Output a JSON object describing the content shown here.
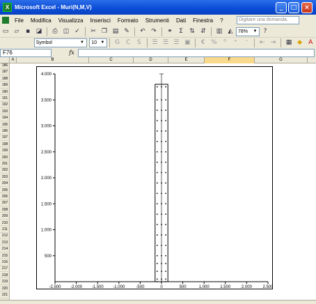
{
  "window": {
    "title": "Microsoft Excel - Muri(N,M,V)",
    "minimize": "_",
    "maximize": "□",
    "close": "×"
  },
  "menu": {
    "items": [
      "File",
      "Modifica",
      "Visualizza",
      "Inserisci",
      "Formato",
      "Strumenti",
      "Dati",
      "Finestra",
      "?"
    ],
    "help_placeholder": "Digitare una domanda."
  },
  "toolbar": {
    "zoom": "78%",
    "font": "Symbol",
    "size": "10"
  },
  "formula_bar": {
    "name_box": "F76",
    "fx": "fx",
    "content": ""
  },
  "sheet": {
    "columns": [
      "A",
      "B",
      "C",
      "D",
      "E",
      "F",
      "G"
    ],
    "selected_column": "F",
    "rows": [
      "186",
      "187",
      "188",
      "189",
      "190",
      "191",
      "192",
      "193",
      "194",
      "195",
      "196",
      "197",
      "198",
      "199",
      "200",
      "201",
      "202",
      "203",
      "204",
      "205",
      "206",
      "207",
      "208",
      "209",
      "210",
      "211",
      "212",
      "213",
      "214",
      "215",
      "216",
      "217",
      "218",
      "219",
      "220",
      "221"
    ]
  },
  "chart_data": {
    "type": "scatter",
    "xlim": [
      -2500,
      2500
    ],
    "ylim": [
      0,
      4000
    ],
    "x_ticks": [
      "-2.500",
      "-2.000",
      "-1.500",
      "-1.000",
      "-500",
      "0",
      "500",
      "1.000",
      "1.500",
      "2.000",
      "2.500"
    ],
    "y_ticks": [
      "500",
      "1.000",
      "1.500",
      "2.000",
      "2.500",
      "3.000",
      "3.500",
      "4.000"
    ],
    "rectangle": {
      "x0": -150,
      "x1": 150,
      "y0": 0,
      "y1": 3800
    },
    "center_line": {
      "x": 0,
      "y0": 0,
      "y1": 4000
    },
    "point_columns_x": [
      -100,
      0,
      100
    ],
    "point_rows_y": [
      0,
      50,
      200,
      350,
      500,
      700,
      900,
      1100,
      1300,
      1500,
      1700,
      1900,
      2100,
      2300,
      2500,
      2700,
      2900,
      3100,
      3300,
      3500,
      3750
    ]
  },
  "colors": {
    "title_bar": "#0a4bd6",
    "chrome": "#ece9d8",
    "selected_header": "#f9d98b"
  }
}
